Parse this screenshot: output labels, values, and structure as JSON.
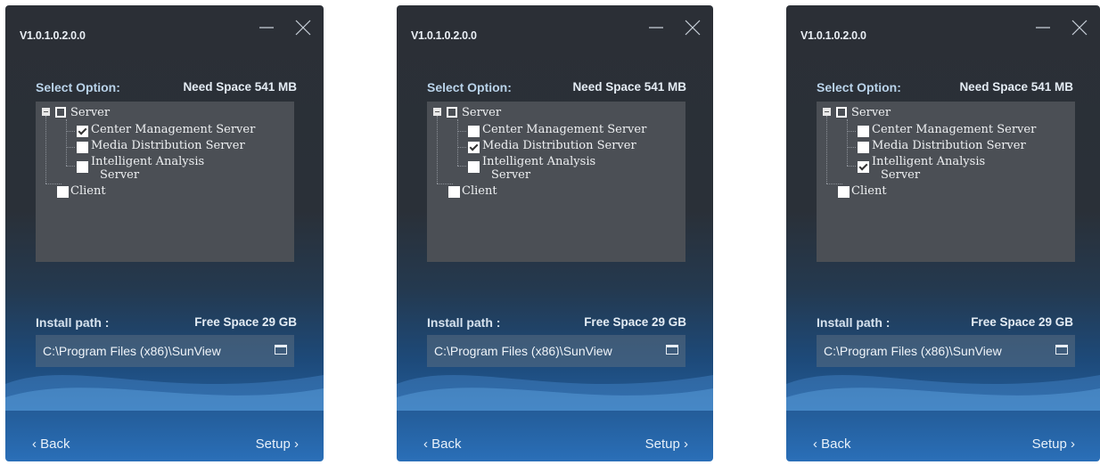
{
  "panels": [
    {
      "version": "V1.0.1.0.2.0.0",
      "select_option_label": "Select Option:",
      "need_space": "Need Space 541 MB",
      "tree": {
        "server": "Server",
        "center": "Center Management Server",
        "media": "Media Distribution Server",
        "intelligent_line1": "Intelligent Analysis",
        "intelligent_line2": "Server",
        "client": "Client"
      },
      "checked": "center",
      "install_path_label": "Install path :",
      "free_space": "Free Space 29 GB",
      "install_path_value": "C:\\Program Files (x86)\\SunView",
      "back_label": "‹ Back",
      "setup_label": "Setup ›"
    },
    {
      "version": "V1.0.1.0.2.0.0",
      "select_option_label": "Select Option:",
      "need_space": "Need Space 541 MB",
      "tree": {
        "server": "Server",
        "center": "Center Management Server",
        "media": "Media Distribution Server",
        "intelligent_line1": "Intelligent Analysis",
        "intelligent_line2": "Server",
        "client": "Client"
      },
      "checked": "media",
      "install_path_label": "Install path :",
      "free_space": "Free Space 29 GB",
      "install_path_value": "C:\\Program Files (x86)\\SunView",
      "back_label": "‹ Back",
      "setup_label": "Setup ›"
    },
    {
      "version": "V1.0.1.0.2.0.0",
      "select_option_label": "Select Option:",
      "need_space": "Need Space 541 MB",
      "tree": {
        "server": "Server",
        "center": "Center Management Server",
        "media": "Media Distribution Server",
        "intelligent_line1": "Intelligent Analysis",
        "intelligent_line2": "Server",
        "client": "Client"
      },
      "checked": "intelligent",
      "install_path_label": "Install path :",
      "free_space": "Free Space 29 GB",
      "install_path_value": "C:\\Program Files (x86)\\SunView",
      "back_label": "‹ Back",
      "setup_label": "Setup ›"
    }
  ],
  "icons": {
    "minimize": "minimize-icon",
    "close": "close-icon",
    "folder": "folder-icon",
    "expander": "tree-collapse-icon"
  },
  "colors": {
    "tree_background": "#4b4f55",
    "accent_blue": "#2a6fb8"
  }
}
